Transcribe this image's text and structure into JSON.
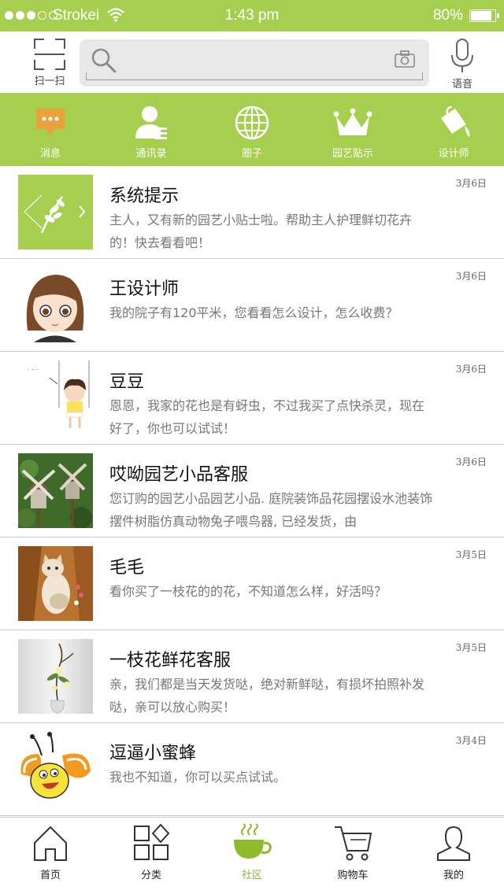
{
  "status_bar": {
    "carrier": "Strokei",
    "time": "1:43 pm",
    "battery": "80%",
    "battery_level": 0.8,
    "signal_dots_filled": 3,
    "signal_dots_total": 5
  },
  "search_row": {
    "scan_label": "扫一扫",
    "search_placeholder": "",
    "voice_label": "语音"
  },
  "tabs": [
    {
      "label": "消息",
      "icon": "message-bubble-icon"
    },
    {
      "label": "通讯录",
      "icon": "contacts-icon"
    },
    {
      "label": "圈子",
      "icon": "globe-icon"
    },
    {
      "label": "园艺贴示",
      "icon": "crown-icon"
    },
    {
      "label": "设计师",
      "icon": "paint-bucket-icon"
    }
  ],
  "messages": [
    {
      "name": "系统提示",
      "date": "3月6日",
      "preview": "主人，又有新的园艺小贴士啦。帮助主人护理鲜切花卉的！快去看看吧！"
    },
    {
      "name": "王设计师",
      "date": "3月6日",
      "preview": "我的院子有120平米，您看看怎么设计，怎么收费？"
    },
    {
      "name": "豆豆",
      "date": "3月6日",
      "preview": "恩恩，我家的花也是有蚜虫，不过我买了点快杀灵，现在好了，你也可以试试！"
    },
    {
      "name": "哎呦园艺小品客服",
      "date": "3月6日",
      "preview": "您订购的园艺小品园艺小品. 庭院装饰品花园摆设水池装饰摆件树脂仿真动物兔子喂鸟器, 已经发货，由"
    },
    {
      "name": "毛毛",
      "date": "3月5日",
      "preview": "看你买了一枝花的的花，不知道怎么样，好活吗？"
    },
    {
      "name": "一枝花鲜花客服",
      "date": "3月5日",
      "preview": "亲，我们都是当天发货哒，绝对新鲜哒，有损坏拍照补发哒，亲可以放心购买！"
    },
    {
      "name": "逗逼小蜜蜂",
      "date": "3月4日",
      "preview": "我也不知道，你可以买点试试。"
    }
  ],
  "bottom_tabs": [
    {
      "label": "首页",
      "icon": "home-icon"
    },
    {
      "label": "分类",
      "icon": "category-icon"
    },
    {
      "label": "社区",
      "icon": "coffee-cup-icon"
    },
    {
      "label": "购物车",
      "icon": "shopping-cart-icon"
    },
    {
      "label": "我的",
      "icon": "user-icon"
    }
  ],
  "colors": {
    "accent": "#a7cf4f",
    "active_tab_text": "#8dbb2c",
    "icon_orange": "#e9a23b"
  }
}
